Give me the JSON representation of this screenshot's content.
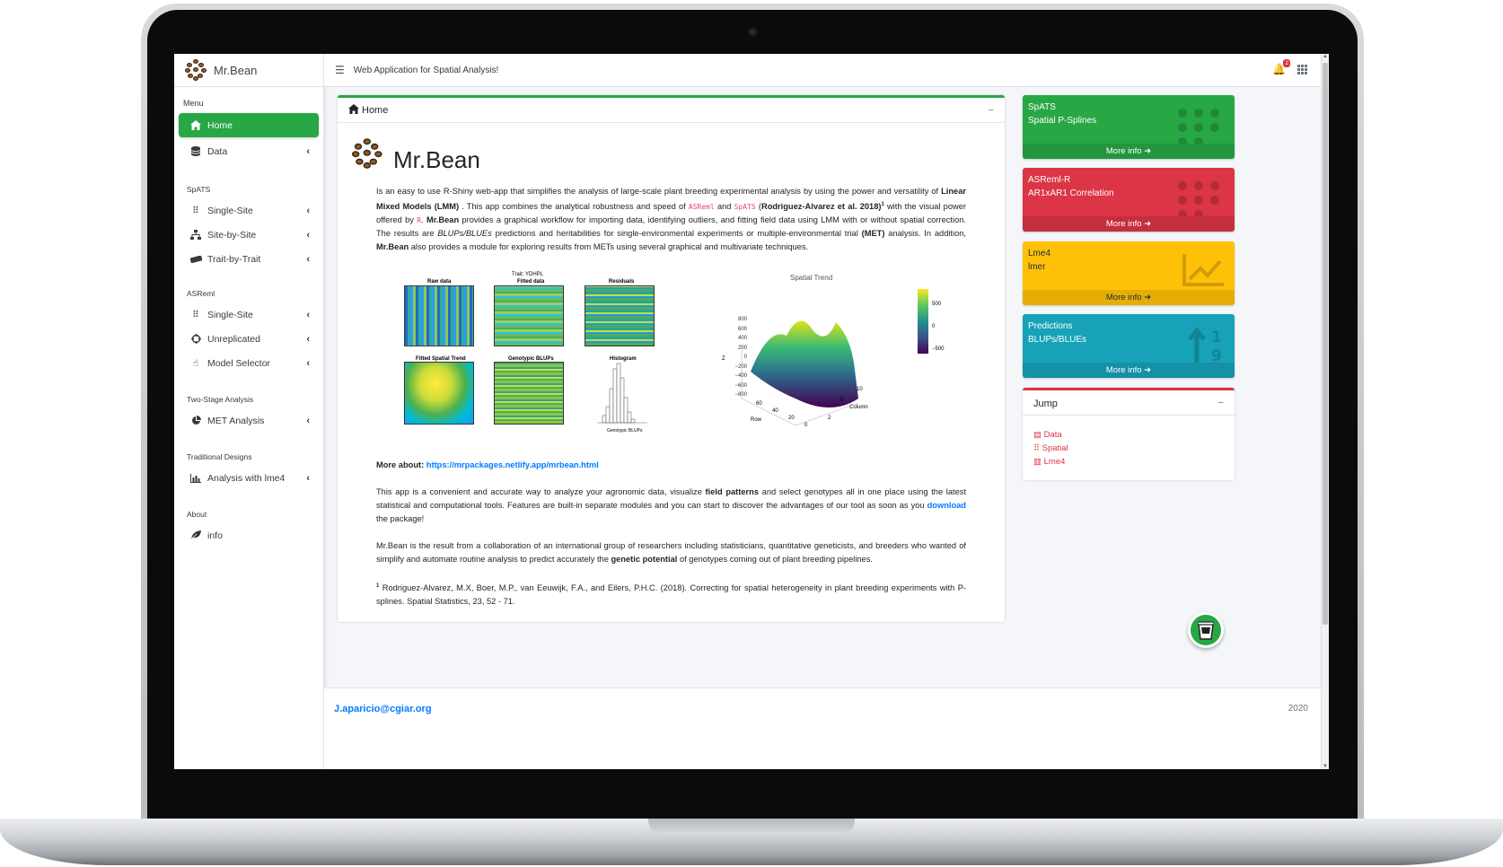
{
  "brand": {
    "name": "Mr.Bean"
  },
  "topbar": {
    "title": "Web Application for Spatial Analysis!",
    "notification_count": "2"
  },
  "sidebar": {
    "menu_header": "Menu",
    "items_top": [
      {
        "label": "Home",
        "icon": "home-icon"
      },
      {
        "label": "Data",
        "icon": "database-icon"
      }
    ],
    "sections": [
      {
        "label": "SpATS",
        "items": [
          {
            "label": "Single-Site"
          },
          {
            "label": "Site-by-Site"
          },
          {
            "label": "Trait-by-Trait"
          }
        ]
      },
      {
        "label": "ASReml",
        "items": [
          {
            "label": "Single-Site"
          },
          {
            "label": "Unreplicated"
          },
          {
            "label": "Model Selector"
          }
        ]
      },
      {
        "label": "Two-Stage Analysis",
        "items": [
          {
            "label": "MET Analysis"
          }
        ]
      },
      {
        "label": "Traditional Designs",
        "items": [
          {
            "label": "Analysis with lme4"
          }
        ]
      },
      {
        "label": "About",
        "items": [
          {
            "label": "info"
          }
        ]
      }
    ]
  },
  "main": {
    "card_title": "Home",
    "hero_title": "Mr.Bean",
    "p1": {
      "a": "Is an easy to use R-Shiny web-app that simplifies the analysis of large-scale plant breeding experimental analysis by using the power and versatility of ",
      "b": "Linear Mixed Models (LMM)",
      "c": " . This app combines the analytical robustness and speed of ",
      "code1": "ASReml",
      "d": " and ",
      "code2": "SpATS",
      "e": " (",
      "f": "Rodriguez-Alvarez et al. 2018)",
      "sup": "1",
      "g": " with the visual power offered by ",
      "code3": "R",
      "h": ". ",
      "i": "Mr.Bean",
      "j": " provides a graphical workflow for importing data, identifying outliers, and fitting field data using LMM with or without spatial correction. The results are ",
      "k": "BLUPs/BLUEs",
      "l": " predictions and heritabilities for single-environmental experiments or multiple-environmental trial ",
      "m": "(MET)",
      "n": " analysis. In addition, ",
      "o": "Mr.Bean",
      "p": " also provides a module for exploring results from METs using several graphical and multivariate techniques."
    },
    "figure": {
      "panel_titles": [
        "Raw data",
        "Fitted data",
        "Residuals",
        "Fitted Spatial Trend",
        "Genotypic BLUPs",
        "Histogram"
      ],
      "trait_label": "Trait: YDHPL",
      "hist_xlabel": "Genotypic BLUPs",
      "surface_title": "Spatial Trend",
      "z_ticks": [
        "800",
        "600",
        "400",
        "200",
        "0",
        "−200",
        "−400",
        "−600",
        "−800"
      ],
      "z_label": "Z",
      "row_label": "Row",
      "col_label": "Column",
      "row_ticks": [
        "60",
        "40",
        "20",
        "0"
      ],
      "col_ticks": [
        "2",
        "5",
        "10"
      ],
      "colorbar_ticks": [
        "500",
        "0",
        "−500"
      ]
    },
    "more_about_label": "More about:",
    "more_about_url": "https://mrpackages.netlify.app/mrbean.html",
    "p2": {
      "a": "This app is a convenient and accurate way to analyze your agronomic data, visualize ",
      "b": "field patterns",
      "c": " and select genotypes all in one place using the latest statistical and computational tools. Features are built-in separate modules and you can start to discover the advantages of our tool as soon as you ",
      "d": "download",
      "e": " the package!"
    },
    "p3": {
      "a": "Mr.Bean is the result from a collaboration of an international group of researchers including statisticians, quantitative geneticists, and breeders who wanted of simplify and automate routine analysis to predict accurately the ",
      "b": "genetic potential",
      "c": " of genotypes coming out of plant breeding pipelines."
    },
    "ref": {
      "sup": "1",
      "text": " Rodriguez-Alvarez, M.X, Boer, M.P., van Eeuwijk, F.A., and Eilers, P.H.C. (2018). Correcting for spatial heterogeneity in plant breeding experiments with P-splines. Spatial Statistics, 23, 52 - 71."
    }
  },
  "info_boxes": [
    {
      "line1": "SpATS",
      "line2": "Spatial P-Splines",
      "more": "More info",
      "color": "#28a745"
    },
    {
      "line1": "ASReml-R",
      "line2": "AR1xAR1 Correlation",
      "more": "More info",
      "color": "#dc3545"
    },
    {
      "line1": "Lme4",
      "line2": "lmer",
      "more": "More info",
      "color": "#ffc107"
    },
    {
      "line1": "Predictions",
      "line2": "BLUPs/BLUEs",
      "more": "More info",
      "color": "#17a2b8"
    }
  ],
  "jump": {
    "title": "Jump",
    "links": [
      "Data",
      "Spatial",
      "Lme4"
    ]
  },
  "footer": {
    "email": "J.aparicio@cgiar.org",
    "year": "2020"
  }
}
